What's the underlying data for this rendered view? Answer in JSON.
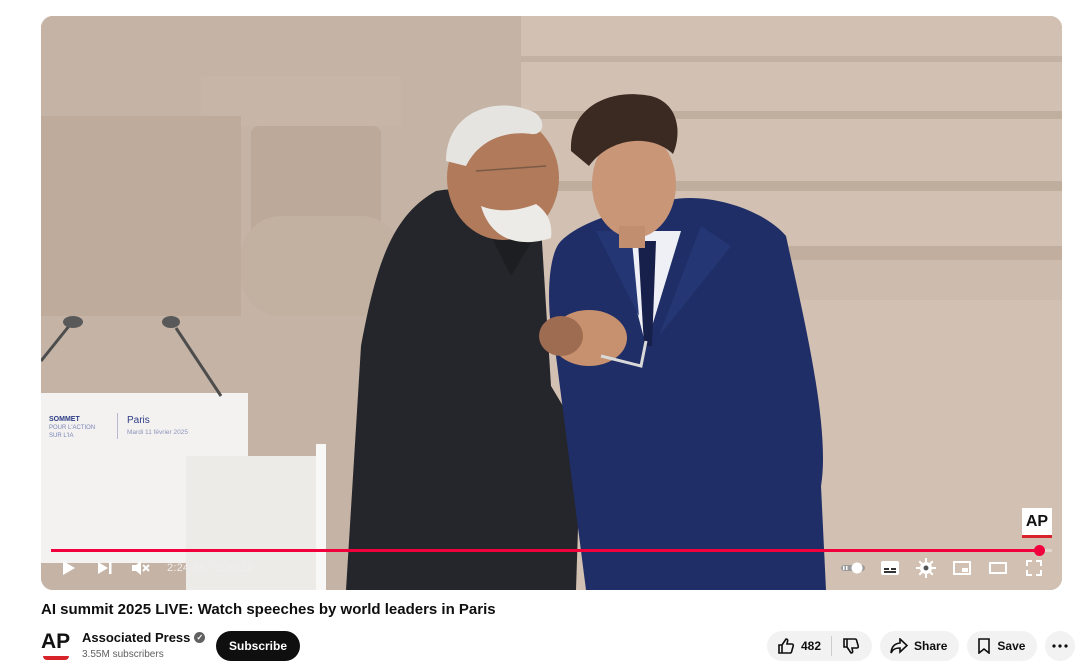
{
  "player": {
    "watermark": "AP",
    "progress_fraction": 0.987,
    "time_display": "2:24:34 / 2:30:22",
    "sign_left": "SOMMET\nPOUR L'ACTION\nSUR L'IA",
    "sign_right": "Paris",
    "sign_date": "Mardi 11 février 2025",
    "icons": [
      "play-icon",
      "next-icon",
      "mute-icon",
      "autoplay-toggle-icon",
      "subtitles-icon",
      "settings-icon",
      "miniplayer-icon",
      "theater-icon",
      "fullscreen-icon"
    ]
  },
  "video": {
    "title": "AI summit 2025 LIVE: Watch speeches by world leaders in Paris"
  },
  "channel": {
    "logo_text": "AP",
    "name": "Associated Press",
    "subscribers": "3.55M subscribers",
    "subscribe_label": "Subscribe"
  },
  "actions": {
    "like_count": "482",
    "share_label": "Share",
    "save_label": "Save"
  },
  "colors": {
    "progress": "#f2003c",
    "subscribe_bg": "#0f0f0f",
    "pill_bg": "#f2f2f2"
  }
}
